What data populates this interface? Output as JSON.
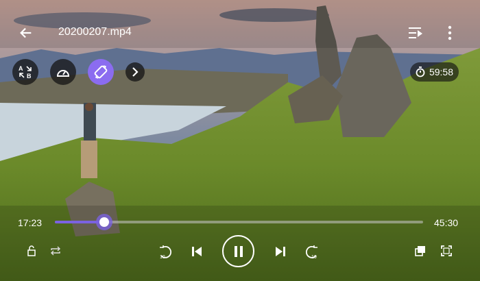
{
  "header": {
    "title": "20200207.mp4",
    "back_icon": "arrow-left-icon",
    "playlist_icon": "playlist-play-icon",
    "more_icon": "more-vertical-icon"
  },
  "quick_actions": [
    {
      "name": "ab-repeat",
      "icon": "ab-repeat-icon"
    },
    {
      "name": "playback-speed",
      "icon": "speedometer-icon"
    },
    {
      "name": "screen-rotate",
      "icon": "rotate-icon",
      "active": true
    },
    {
      "name": "expand",
      "icon": "chevron-right-icon"
    }
  ],
  "sleep_timer": {
    "icon": "timer-icon",
    "value": "59:58"
  },
  "playback": {
    "current_time": "17:23",
    "total_time": "45:30",
    "progress_fraction": 0.134
  },
  "colors": {
    "accent": "#7b62e0"
  },
  "controls": [
    "lock-icon",
    "repeat-icon",
    "rewind-10-icon",
    "previous-icon",
    "pause-icon",
    "next-icon",
    "forward-10-icon",
    "pip-icon",
    "fit-screen-icon"
  ]
}
